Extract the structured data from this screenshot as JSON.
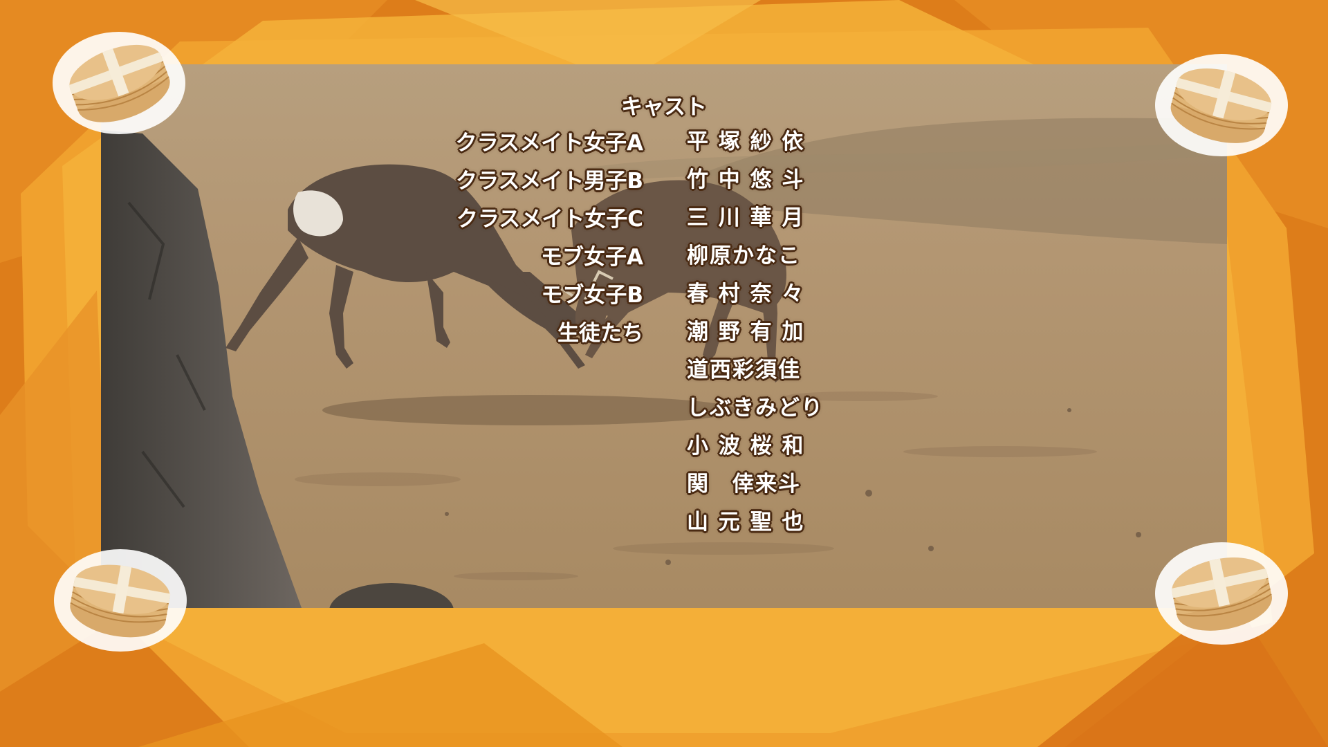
{
  "credits": {
    "heading": "キャスト",
    "roles": [
      "クラスメイト女子A",
      "クラスメイト男子B",
      "クラスメイト女子C",
      "モブ女子A",
      "モブ女子B",
      "生徒たち"
    ],
    "names": [
      "平 塚 紗 依",
      "竹 中 悠 斗",
      "三 川 華 月",
      "柳原かなこ",
      "春 村 奈 々",
      "潮 野 有 加",
      "道西彩須佳",
      "しぶきみどり",
      "小 波 桜 和",
      "関　倖来斗",
      "山 元 聖 也"
    ]
  },
  "colors": {
    "frame_orange": "#e0821c",
    "frame_light": "#f4b23a",
    "text_fill": "#ffffff",
    "text_outline": "#4a2a12"
  },
  "scene": {
    "subject": "two-deer-locking-antlers",
    "decoration": "crepe-stack-icons"
  }
}
